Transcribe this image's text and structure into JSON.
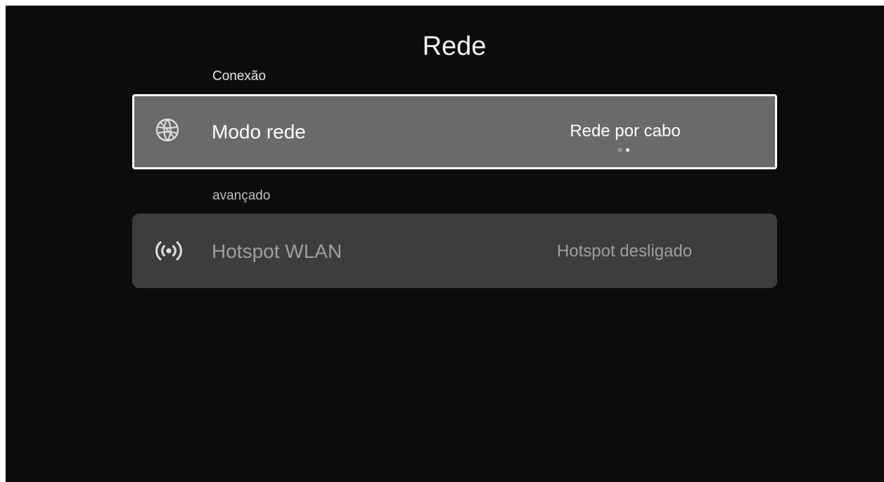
{
  "page": {
    "title": "Rede",
    "background_color": "#0d0c0b"
  },
  "sections": [
    {
      "label": "Conexão",
      "items": [
        {
          "label": "Modo rede",
          "value": "Rede por cabo",
          "icon": "network-globe-icon",
          "focused": true,
          "value_pages": 2,
          "value_page_active": 2
        }
      ]
    },
    {
      "label": "avançado",
      "items": [
        {
          "label": "Hotspot WLAN",
          "value": "Hotspot desligado",
          "icon": "hotspot-icon",
          "focused": false
        }
      ]
    }
  ],
  "colors": {
    "focused_row": "#6a6a6b",
    "normal_row": "#3d3d3e",
    "focus_border": "#ffffff",
    "dim_text": "#9e9e9e"
  }
}
